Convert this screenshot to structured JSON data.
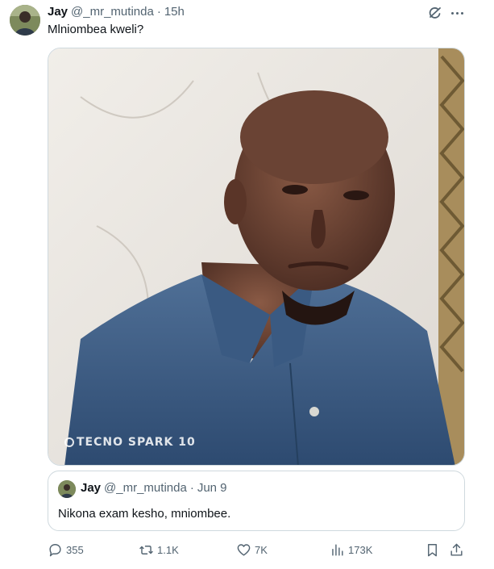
{
  "tweet": {
    "author_name": "Jay",
    "author_handle": "@_mr_mutinda",
    "separator": "·",
    "time": "15h",
    "text": "Mlniombea kweli?",
    "media_watermark": "TECNO SPARK 10"
  },
  "quoted_tweet": {
    "author_name": "Jay",
    "author_handle": "@_mr_mutinda",
    "separator": "·",
    "date": "Jun 9",
    "text": "Nikona exam kesho, mniombee."
  },
  "actions": {
    "replies": "355",
    "retweets": "1.1K",
    "likes": "7K",
    "views": "173K"
  },
  "icons": {
    "header": [
      "grok-icon",
      "more-icon"
    ],
    "actions": [
      "reply-icon",
      "retweet-icon",
      "like-icon",
      "views-icon",
      "bookmark-icon",
      "share-icon"
    ]
  },
  "colors": {
    "text_primary": "#0f1419",
    "text_secondary": "#536471",
    "border": "#cfd9de"
  }
}
